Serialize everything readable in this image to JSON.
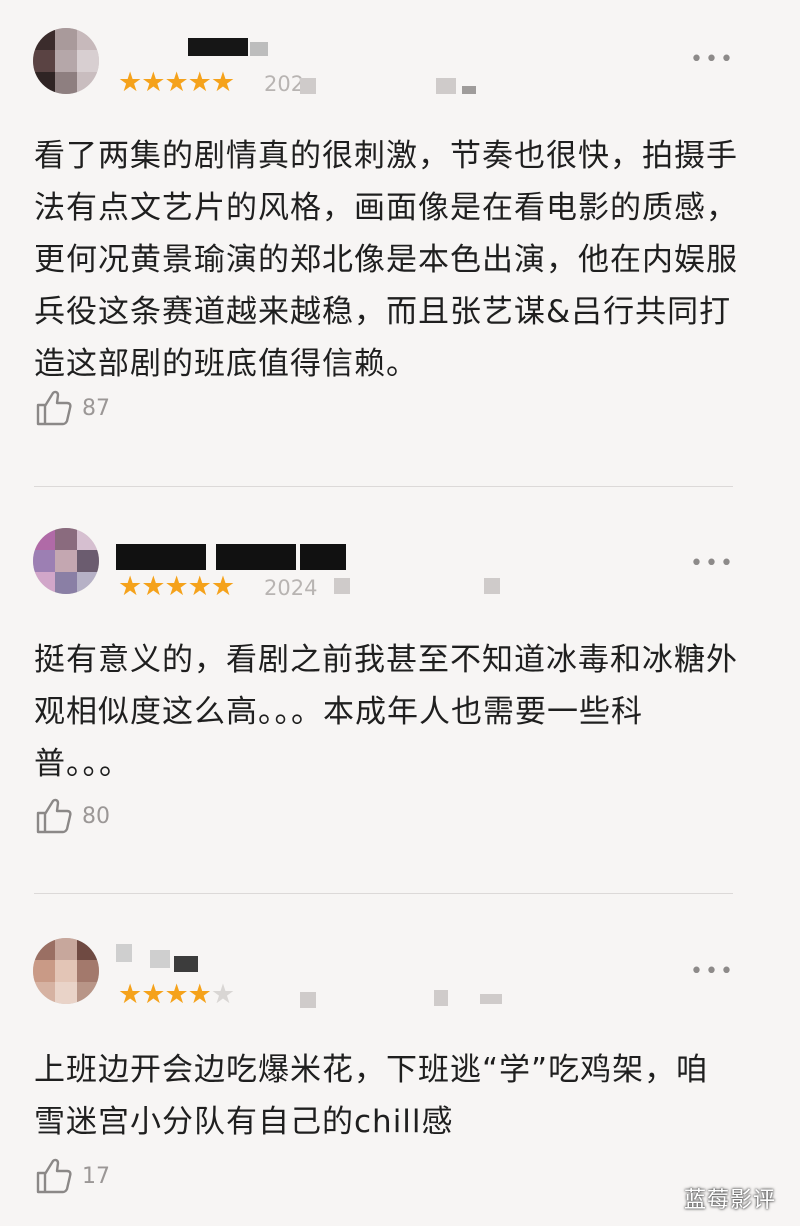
{
  "reviews": [
    {
      "rating": 5,
      "date": "202",
      "text": "看了两集的剧情真的很刺激，节奏也很快，拍摄手法有点文艺片的风格，画面像是在看电影的质感，更何况黄景瑜演的郑北像是本色出演，他在内娱服兵役这条赛道越来越稳，而且张艺谋&吕行共同打造这部剧的班底值得信赖。",
      "likes": "87"
    },
    {
      "rating": 5,
      "date": "2024",
      "text": "挺有意义的，看剧之前我甚至不知道冰毒和冰糖外观相似度这么高。。。本成年人也需要一些科普。。。",
      "likes": "80"
    },
    {
      "rating": 4,
      "date": "",
      "text": "上班边开会边吃爆米花，下班逃“学”吃鸡架，咱雪迷宫小分队有自己的chill感",
      "likes": "17"
    }
  ],
  "icons": {
    "more": "more-dots-icon",
    "like": "thumbs-up-icon",
    "star": "star-icon"
  },
  "colors": {
    "star": "#f5a21b",
    "background": "#f7f5f4"
  },
  "watermark": "蓝莓影评"
}
